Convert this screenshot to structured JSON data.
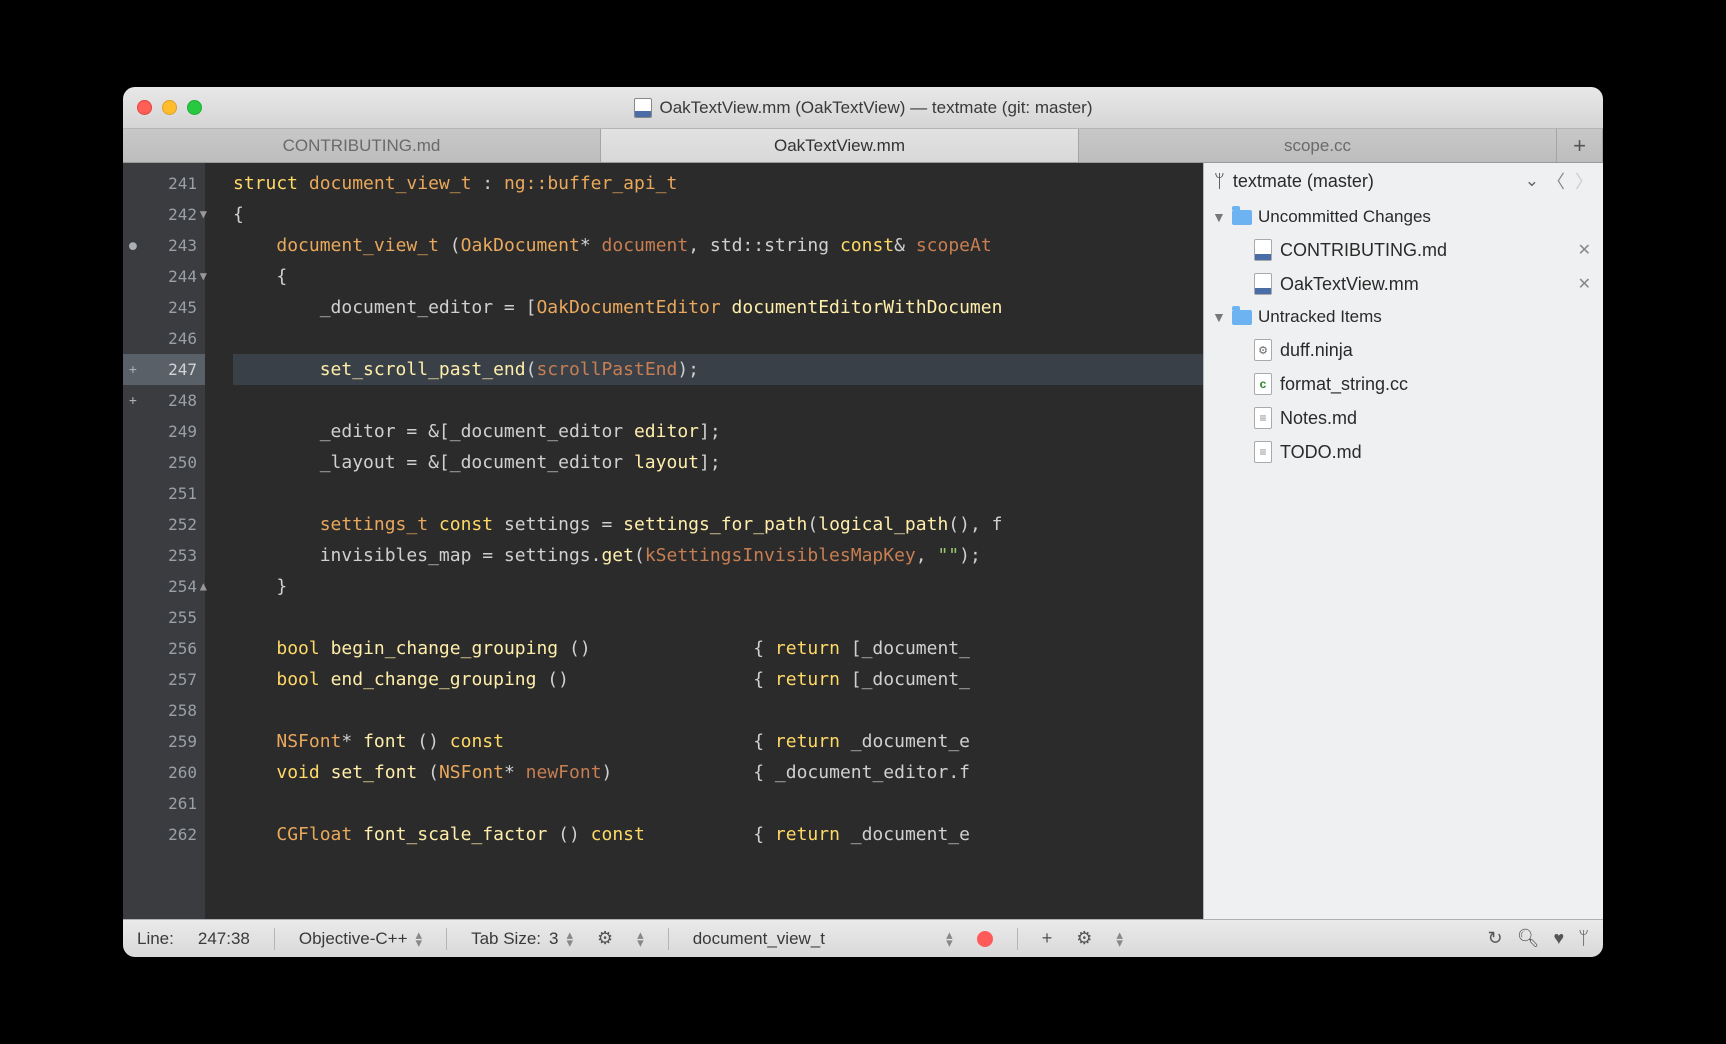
{
  "window": {
    "title": "OakTextView.mm (OakTextView) — textmate (git: master)"
  },
  "tabs": [
    {
      "label": "CONTRIBUTING.md",
      "active": false
    },
    {
      "label": "OakTextView.mm",
      "active": true
    },
    {
      "label": "scope.cc",
      "active": false
    }
  ],
  "gutter": {
    "start": 241,
    "end": 262,
    "current": 247,
    "markers": {
      "243": "●",
      "247": "+",
      "248": "+"
    },
    "folds": {
      "242": "▼",
      "244": "▼",
      "254": "▲"
    }
  },
  "code_lines": [
    "struct document_view_t : ng::buffer_api_t",
    "{",
    "    document_view_t (OakDocument* document, std::string const& scopeAt",
    "    {",
    "        _document_editor = [OakDocumentEditor documentEditorWithDocumen",
    "",
    "        set_scroll_past_end(scrollPastEnd);",
    "",
    "        _editor = &[_document_editor editor];",
    "        _layout = &[_document_editor layout];",
    "",
    "        settings_t const settings = settings_for_path(logical_path(), f",
    "        invisibles_map = settings.get(kSettingsInvisiblesMapKey, \"\");",
    "    }",
    "",
    "    bool begin_change_grouping ()               { return [_document_",
    "    bool end_change_grouping ()                 { return [_document_",
    "",
    "    NSFont* font () const                       { return _document_e",
    "    void set_font (NSFont* newFont)             { _document_editor.f",
    "",
    "    CGFloat font_scale_factor () const          { return _document_e"
  ],
  "scm": {
    "title": "textmate (master)",
    "groups": [
      {
        "label": "Uncommitted Changes",
        "items": [
          {
            "name": "CONTRIBUTING.md",
            "icon": "blue",
            "closable": true
          },
          {
            "name": "OakTextView.mm",
            "icon": "blue",
            "closable": true
          }
        ]
      },
      {
        "label": "Untracked Items",
        "items": [
          {
            "name": "duff.ninja",
            "icon": "gear",
            "closable": false
          },
          {
            "name": "format_string.cc",
            "icon": "c",
            "closable": false
          },
          {
            "name": "Notes.md",
            "icon": "txt",
            "closable": false
          },
          {
            "name": "TODO.md",
            "icon": "txt",
            "closable": false
          }
        ]
      }
    ]
  },
  "status": {
    "line_label": "Line:",
    "position": "247:38",
    "language": "Objective-C++",
    "tab_label": "Tab Size:",
    "tab_size": "3",
    "symbol": "document_view_t"
  }
}
